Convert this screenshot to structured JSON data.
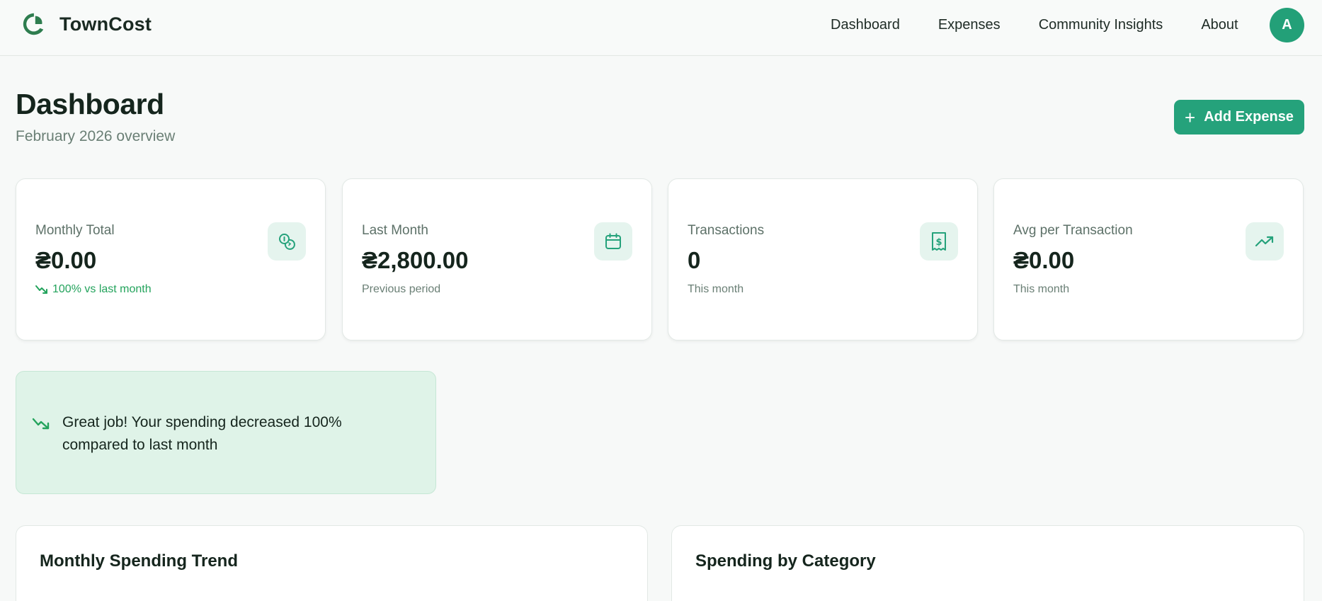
{
  "app": {
    "name": "TownCost",
    "avatar_initial": "A",
    "accent_color": "#25a27b"
  },
  "nav": {
    "items": [
      {
        "label": "Dashboard"
      },
      {
        "label": "Expenses"
      },
      {
        "label": "Community Insights"
      },
      {
        "label": "About"
      }
    ]
  },
  "header": {
    "title": "Dashboard",
    "subtitle": "February 2026 overview",
    "add_button_label": "Add Expense"
  },
  "stats": [
    {
      "label": "Monthly Total",
      "value": "₴0.00",
      "note": "100% vs last month",
      "icon": "coins-icon"
    },
    {
      "label": "Last Month",
      "value": "₴2,800.00",
      "note": "Previous period",
      "icon": "calendar-icon"
    },
    {
      "label": "Transactions",
      "value": "0",
      "note": "This month",
      "icon": "receipt-icon"
    },
    {
      "label": "Avg per Transaction",
      "value": "₴0.00",
      "note": "This month",
      "icon": "trending-up-icon"
    }
  ],
  "alert": {
    "message": "Great job! Your spending decreased 100% compared to last month",
    "icon": "trending-down-icon"
  },
  "panels": {
    "trend_title": "Monthly Spending Trend",
    "category_title": "Spending by Category"
  }
}
